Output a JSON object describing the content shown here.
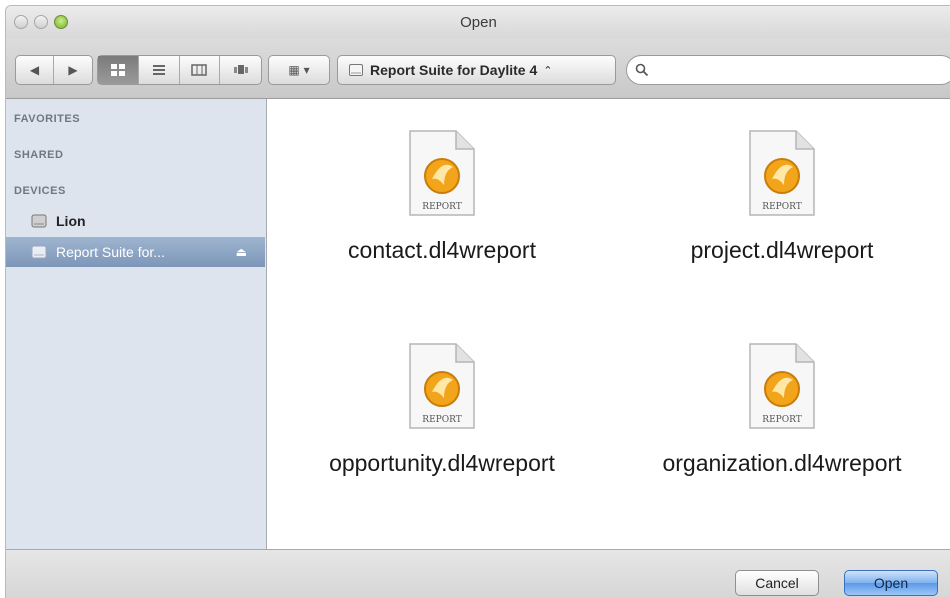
{
  "window": {
    "title": "Open"
  },
  "toolbar": {
    "back_icon": "◀",
    "forward_icon": "▶",
    "view_modes": [
      "icon",
      "list",
      "column",
      "coverflow"
    ],
    "arrange_icon": "▦",
    "arrange_chevron": "▾",
    "location": "Report Suite for Daylite 4",
    "location_chevron": "⌃",
    "search_placeholder": ""
  },
  "sidebar": {
    "sections": {
      "favorites": "FAVORITES",
      "shared": "SHARED",
      "devices": "DEVICES"
    },
    "devices": [
      {
        "label": "Lion",
        "selected": false
      },
      {
        "label": "Report Suite for...",
        "selected": true,
        "eject": "⏏"
      }
    ]
  },
  "files": [
    {
      "name": "contact.dl4wreport",
      "badge": "REPORT"
    },
    {
      "name": "project.dl4wreport",
      "badge": "REPORT"
    },
    {
      "name": "opportunity.dl4wreport",
      "badge": "REPORT"
    },
    {
      "name": "organization.dl4wreport",
      "badge": "REPORT"
    }
  ],
  "buttons": {
    "cancel": "Cancel",
    "open": "Open"
  },
  "colors": {
    "sidebar_bg": "#dde4ee",
    "selection": "#7d97b9",
    "default_button": "#5b9ae8",
    "report_icon": "#f2a41a"
  }
}
